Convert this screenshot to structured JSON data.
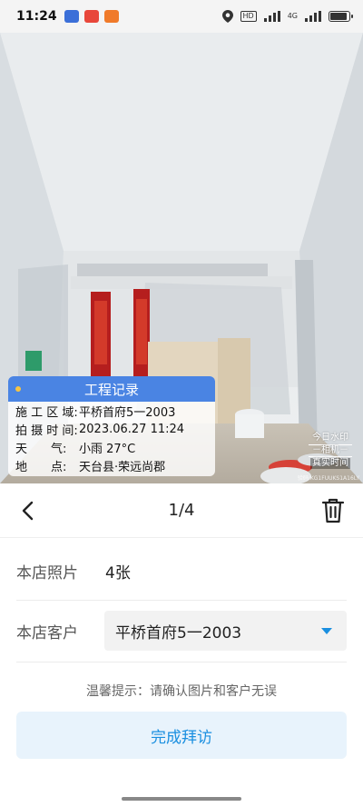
{
  "status_bar": {
    "time": "11:24",
    "right_chip": "HD",
    "net_label": "4G",
    "battery_level": 0.8
  },
  "photo": {
    "description": "",
    "watermark": {
      "title": "工程记录",
      "rows": [
        {
          "key": "施 工 区 域:",
          "value": "平桥首府5一2003"
        },
        {
          "key": "拍 摄 时 间:",
          "value": "2023.06.27 11:24"
        },
        {
          "key": "天　　气:",
          "value": "小雨 27°C"
        },
        {
          "key": "地　　点:",
          "value": "天台县·荣远尚郡"
        }
      ]
    },
    "stamp": {
      "line1": "今日水印",
      "line2": "－相机－",
      "line3": "真实时间",
      "code": "验码:KG1FUUKS1A16LY"
    }
  },
  "nav": {
    "pager": "1/4"
  },
  "form": {
    "photos_label": "本店照片",
    "photos_value": "4张",
    "customer_label": "本店客户",
    "customer_value": "平桥首府5一2003"
  },
  "hint": "温馨提示：请确认图片和客户无误",
  "primary_button": "完成拜访"
}
